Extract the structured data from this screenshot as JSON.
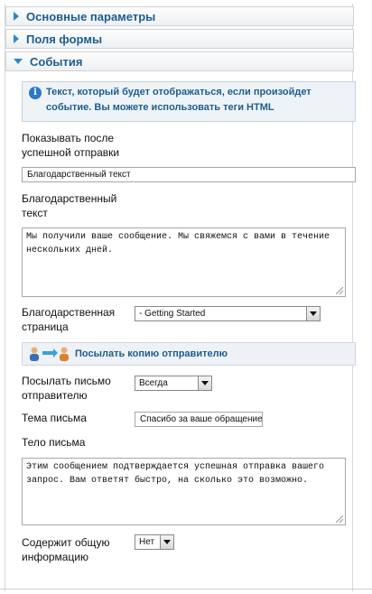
{
  "accordion": {
    "section1": "Основные параметры",
    "section2": "Поля формы",
    "section3": "События"
  },
  "info_text": "Текст, который будет отображаться, если произойдет событие. Вы можете использовать теги HTML",
  "form": {
    "show_after_label": "Показывать после успешной отправки",
    "show_after_value": "Благодарственный текст",
    "thank_text_label": "Благодарственный текст",
    "thank_text_value": "Мы получили ваше сообщение. Мы свяжемся с вами в течение нескольких дней.",
    "thank_page_label": "Благодарственная страница",
    "thank_page_value": "- Getting Started"
  },
  "copy_section": {
    "title": "Посылать копию отправителю",
    "send_label": "Посылать письмо отправителю",
    "send_value": "Всегда",
    "subject_label": "Тема письма",
    "subject_value": "Спасибо за ваше обращение",
    "body_label": "Тело письма",
    "body_value": "Этим сообщением подтверждается успешная отправка вашего запрос. Вам ответят быстро, на сколько это возможно.",
    "info_label": "Содержит общую информацию",
    "info_value": "Нет"
  },
  "icons": {
    "info": "info-icon",
    "users": "users-send-icon",
    "expand": "triangle-right-icon",
    "collapse": "triangle-down-icon"
  },
  "colors": {
    "heading": "#1d5e8f",
    "triangle": "#2a88cf",
    "info_bg": "#eef3f7"
  }
}
